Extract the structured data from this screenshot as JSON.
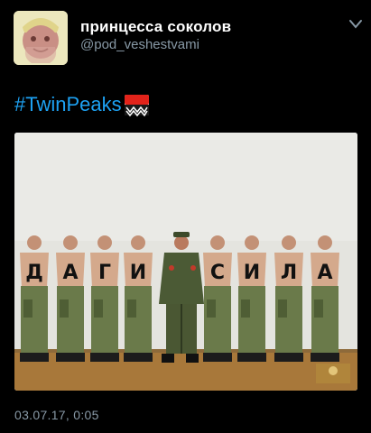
{
  "tweet": {
    "author": {
      "display_name": "принцесса соколов",
      "handle": "@pod_veshestvami",
      "avatar_icon": "avatar-portrait"
    },
    "menu_icon": "chevron-down-icon",
    "hashtag": "#TwinPeaks",
    "emoji_icon": "kalmykia-flag-emoji",
    "image": {
      "description_icon": "photo",
      "back_letters": [
        "Д",
        "А",
        "Г",
        "И",
        "",
        "С",
        "И",
        "Л",
        "А"
      ]
    },
    "timestamp": "03.07.17, 0:05"
  },
  "colors": {
    "background": "#000000",
    "link": "#1da1f2",
    "secondary_text": "#8899a6",
    "primary_text": "#ffffff"
  }
}
